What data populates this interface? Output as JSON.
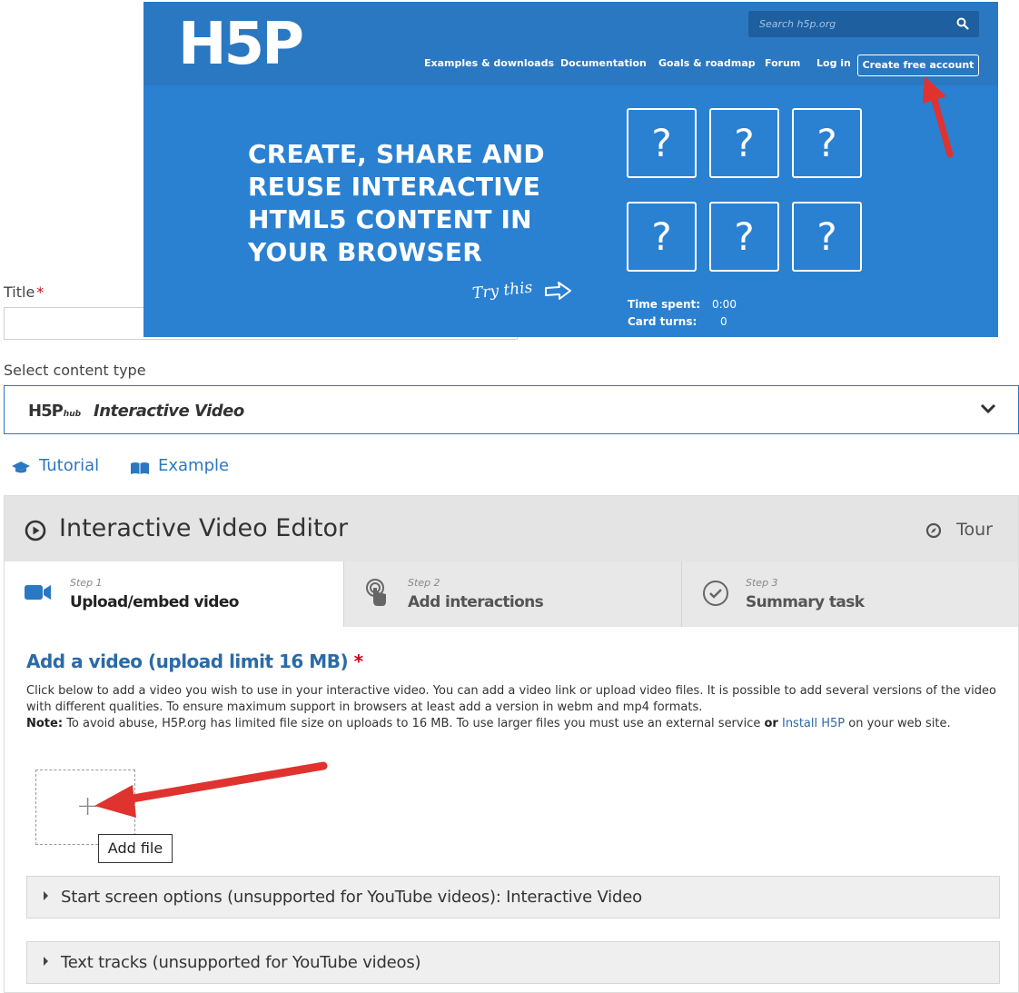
{
  "form": {
    "title_label": "Title",
    "required_mark": "*",
    "title_value": "",
    "content_type_label": "Select content type",
    "content_type_hub_logo": "H5P",
    "content_type_hub_suffix": "hub",
    "content_type_selected": "Interactive Video"
  },
  "banner": {
    "logo": "H5P",
    "search_placeholder": "Search h5p.org",
    "nav": [
      "Examples & downloads",
      "Documentation",
      "Goals & roadmap",
      "Forum",
      "Log in"
    ],
    "cta": "Create free account",
    "headline": "CREATE, SHARE AND REUSE INTERACTIVE HTML5 CONTENT IN YOUR BROWSER",
    "try_this": "Try this",
    "cards": [
      "?",
      "?",
      "?",
      "?",
      "?",
      "?"
    ],
    "stats": [
      {
        "label": "Time spent:",
        "value": "0:00"
      },
      {
        "label": "Card turns:",
        "value": "0"
      }
    ]
  },
  "links": {
    "tutorial": "Tutorial",
    "example": "Example"
  },
  "editor": {
    "title": "Interactive Video Editor",
    "tour": "Tour",
    "steps": [
      {
        "num": "Step 1",
        "name": "Upload/embed video"
      },
      {
        "num": "Step 2",
        "name": "Add interactions"
      },
      {
        "num": "Step 3",
        "name": "Summary task"
      }
    ],
    "video_heading": "Add a video (upload limit 16 MB)",
    "video_desc_1": "Click below to add a video you wish to use in your interactive video. You can add a video link or upload video files. It is possible to add several versions of the video with different qualities. To ensure maximum support in browsers at least add a version in webm and mp4 formats.",
    "note_label": "Note:",
    "note_text": "To avoid abuse, H5P.org has limited file size on uploads to 16 MB. To use larger files you must use an external service",
    "note_or": "or",
    "note_link": "Install H5P",
    "note_tail": "on your web site.",
    "add_plus": "+",
    "add_file_tooltip": "Add file",
    "groups": [
      "Start screen options (unsupported for YouTube videos): Interactive Video",
      "Text tracks (unsupported for YouTube videos)"
    ]
  },
  "colors": {
    "banner_blue": "#2a80d1",
    "link_blue": "#2b78c2",
    "arrow_red": "#e0322e",
    "required_red": "#d0021b"
  }
}
